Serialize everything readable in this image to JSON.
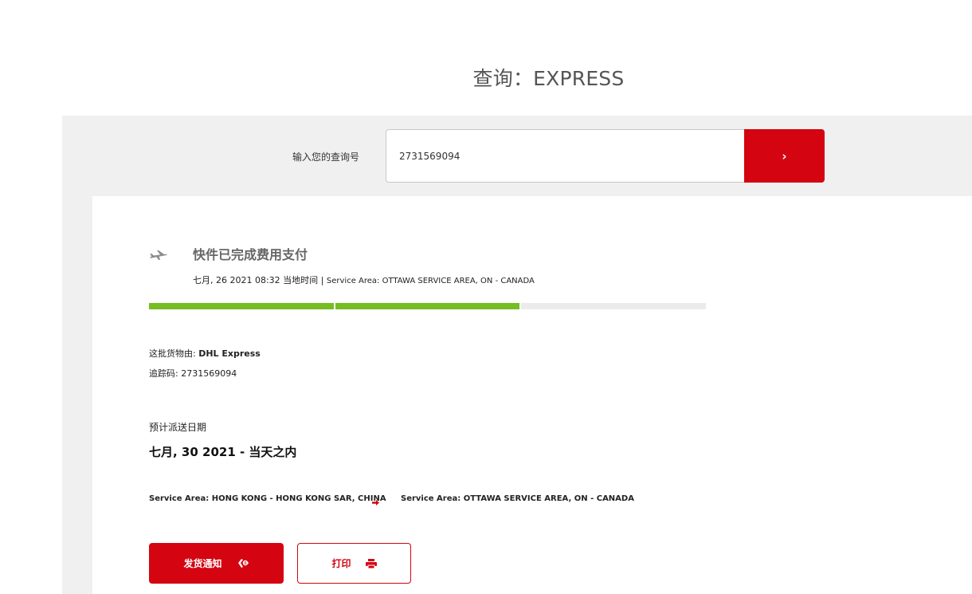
{
  "page": {
    "title": "查询：EXPRESS"
  },
  "search": {
    "label": "输入您的查询号",
    "value": "2731569094",
    "button_label": "›"
  },
  "status": {
    "icon": "airplane-icon",
    "title": "快件已完成费用支付",
    "datetime": "七月, 26 2021 08:32 当地时间",
    "separator": "|",
    "service_area": "Service Area: OTTAWA SERVICE AREA, ON - CANADA",
    "progress_steps_done": 2,
    "progress_steps_total": 3,
    "colors": {
      "done": "#76bd22",
      "pending": "#ebebeb"
    }
  },
  "shipment": {
    "carrier_label": "这批货物由:",
    "carrier": "DHL Express",
    "tracking_label": "追踪码:",
    "tracking_number": "2731569094"
  },
  "delivery": {
    "label": "预计派送日期",
    "value": "七月, 30 2021 - 当天之内"
  },
  "route": {
    "origin": "Service Area: HONG KONG - HONG KONG SAR, CHINA",
    "destination": "Service Area: OTTAWA SERVICE AREA, ON - CANADA",
    "arrow_icon": "arrow-right-icon"
  },
  "actions": {
    "notify_label": "发货通知",
    "notify_icon": "hand-notify-icon",
    "print_label": "打印",
    "print_icon": "printer-icon"
  },
  "colors": {
    "brand_red": "#d40511",
    "band_gray": "#f0f0f0"
  }
}
